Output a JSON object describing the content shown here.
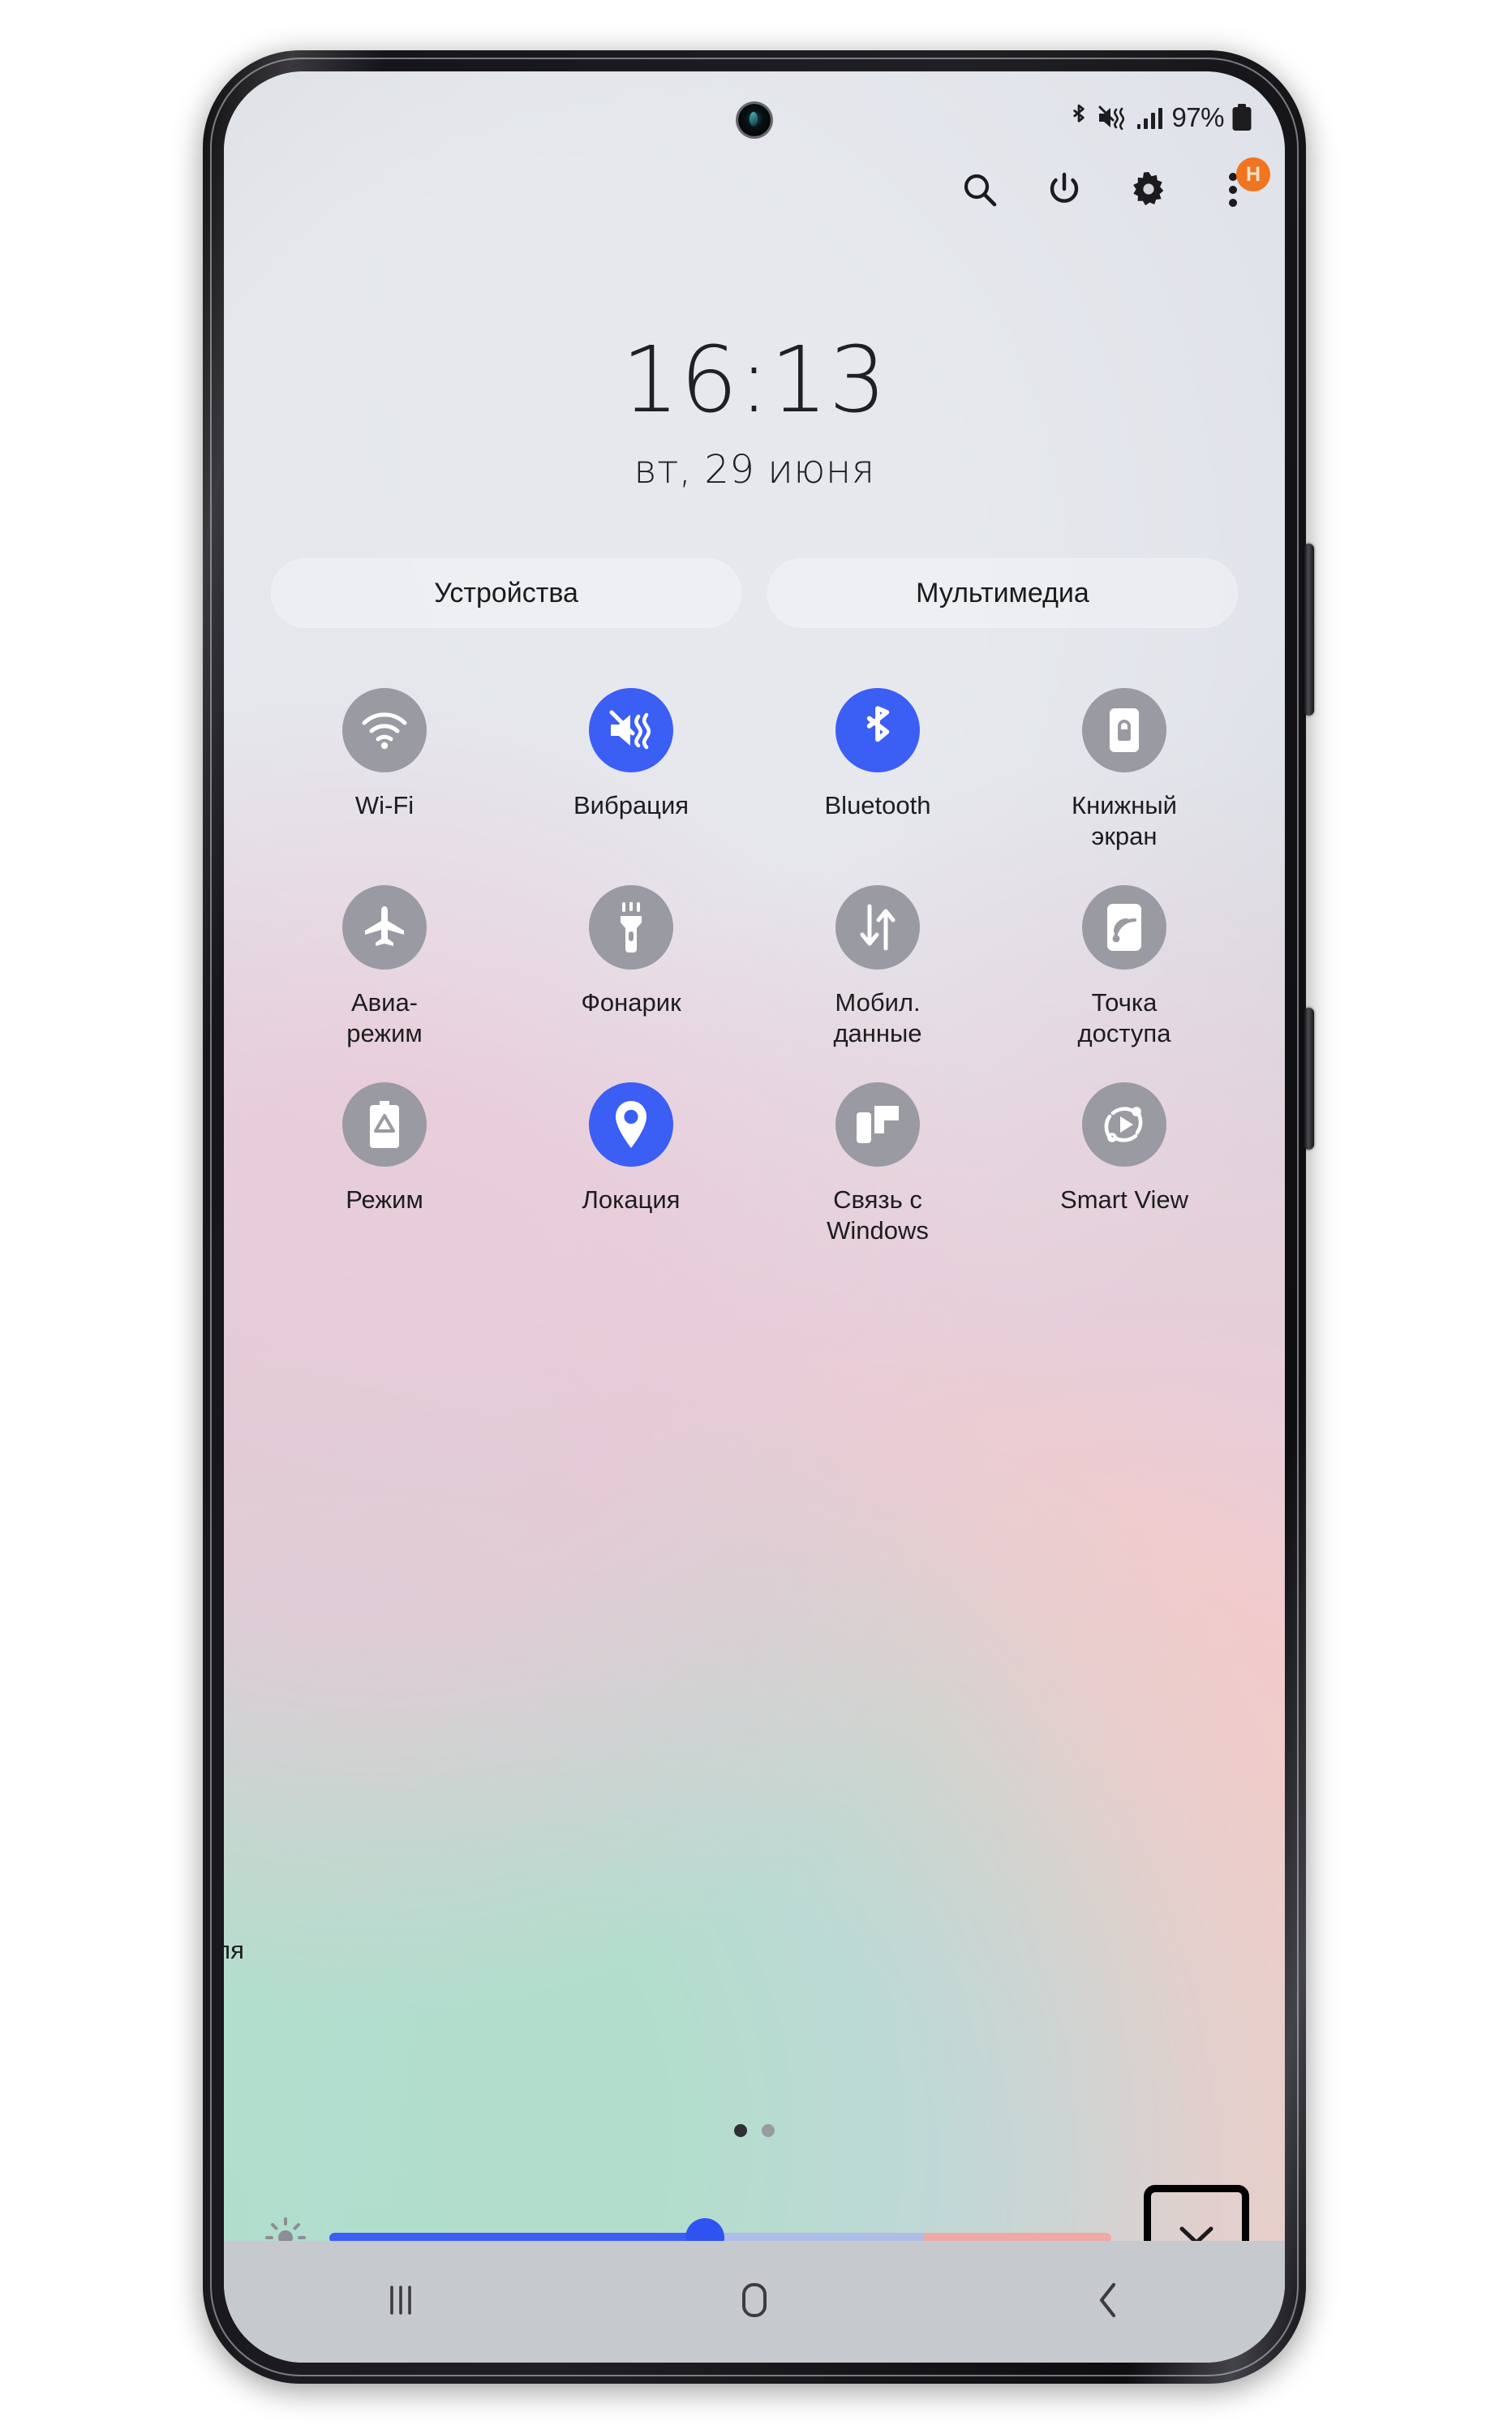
{
  "device": {
    "hardware": {
      "volume_button": "volume-rocker",
      "power_button": "power-button",
      "camera": "front-camera-punch-hole"
    }
  },
  "status_bar": {
    "bluetooth_icon": "bluetooth-icon",
    "sound_mode_icon": "vibrate-mute-icon",
    "signal_icon": "cellular-signal-icon",
    "battery_percent": "97%",
    "battery_icon": "battery-full-icon"
  },
  "header": {
    "search_label": "search-icon",
    "power_label": "power-icon",
    "settings_label": "gear-icon",
    "more_label": "more-options-icon",
    "user_badge": "H"
  },
  "clock": {
    "time": "16:13",
    "date": "вт, 29 июня"
  },
  "pills": [
    {
      "label": "Устройства"
    },
    {
      "label": "Мультимедиа"
    }
  ],
  "toggles": {
    "rows": [
      [
        {
          "label": "Wi-Fi",
          "icon": "wifi-icon",
          "state": "off"
        },
        {
          "label": "Вибрация",
          "icon": "vibrate-icon",
          "state": "on"
        },
        {
          "label": "Bluetooth",
          "icon": "bluetooth-icon",
          "state": "on"
        },
        {
          "label": "Книжный\nэкран",
          "icon": "screen-rotation-lock-icon",
          "state": "off"
        }
      ],
      [
        {
          "label": "Авиа-\nрежим",
          "icon": "airplane-icon",
          "state": "off"
        },
        {
          "label": "Фонарик",
          "icon": "flashlight-icon",
          "state": "off"
        },
        {
          "label": "Мобил.\nданные",
          "icon": "mobile-data-icon",
          "state": "off"
        },
        {
          "label": "Точка\nдоступа",
          "icon": "hotspot-icon",
          "state": "off"
        }
      ],
      [
        {
          "label": "Режим",
          "icon": "power-saving-icon",
          "state": "off"
        },
        {
          "label": "Локация",
          "icon": "location-pin-icon",
          "state": "on"
        },
        {
          "label": "Связь с\nWindows",
          "icon": "link-to-windows-icon",
          "state": "off"
        },
        {
          "label": "Smart View",
          "icon": "smart-view-icon",
          "state": "off"
        }
      ]
    ],
    "clipped_left_label": "ля"
  },
  "pagination": {
    "pages": 2,
    "active": 1
  },
  "brightness": {
    "icon": "brightness-sun-icon",
    "value_percent": 48,
    "expand_icon": "chevron-down-icon"
  },
  "nav_bar": {
    "recents": "recents-icon",
    "home": "home-icon",
    "back": "back-icon"
  },
  "colors": {
    "accent_blue": "#3b5ef5",
    "toggle_off_gray": "#9a9aa2",
    "badge_orange": "#f07521"
  }
}
